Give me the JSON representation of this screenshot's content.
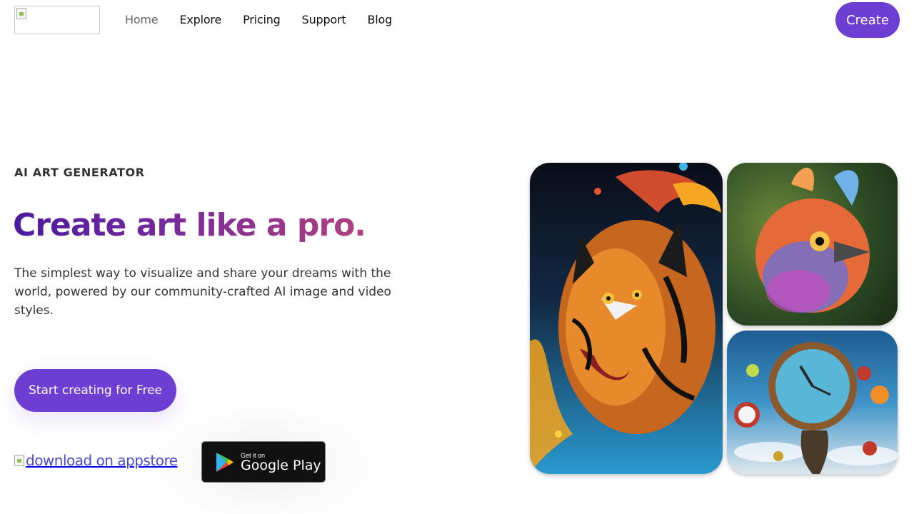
{
  "nav": {
    "logo_alt": "",
    "items": [
      {
        "label": "Home",
        "active": true
      },
      {
        "label": "Explore",
        "active": false
      },
      {
        "label": "Pricing",
        "active": false
      },
      {
        "label": "Support",
        "active": false
      },
      {
        "label": "Blog",
        "active": false
      }
    ],
    "create_label": "Create"
  },
  "hero": {
    "eyebrow": "AI ART GENERATOR",
    "headline": "Create art like a pro.",
    "subtitle": "The simplest way to visualize and share your dreams with the world, powered by our community-crafted AI image and video styles.",
    "cta_label": "Start creating for Free",
    "appstore_alt": "download on appstore",
    "googleplay": {
      "small": "Get it on",
      "big": "Google Play"
    }
  },
  "gallery": [
    {
      "name": "tiger-art",
      "subject": "tiger with paint splash"
    },
    {
      "name": "bird-art",
      "subject": "colorful bird"
    },
    {
      "name": "clock-art",
      "subject": "melting clock with apples"
    }
  ],
  "colors": {
    "accent": "#6e3ed2",
    "headline_gradient_start": "#4b1aa0",
    "headline_gradient_end": "#b0417e",
    "link": "#4a4acb"
  }
}
